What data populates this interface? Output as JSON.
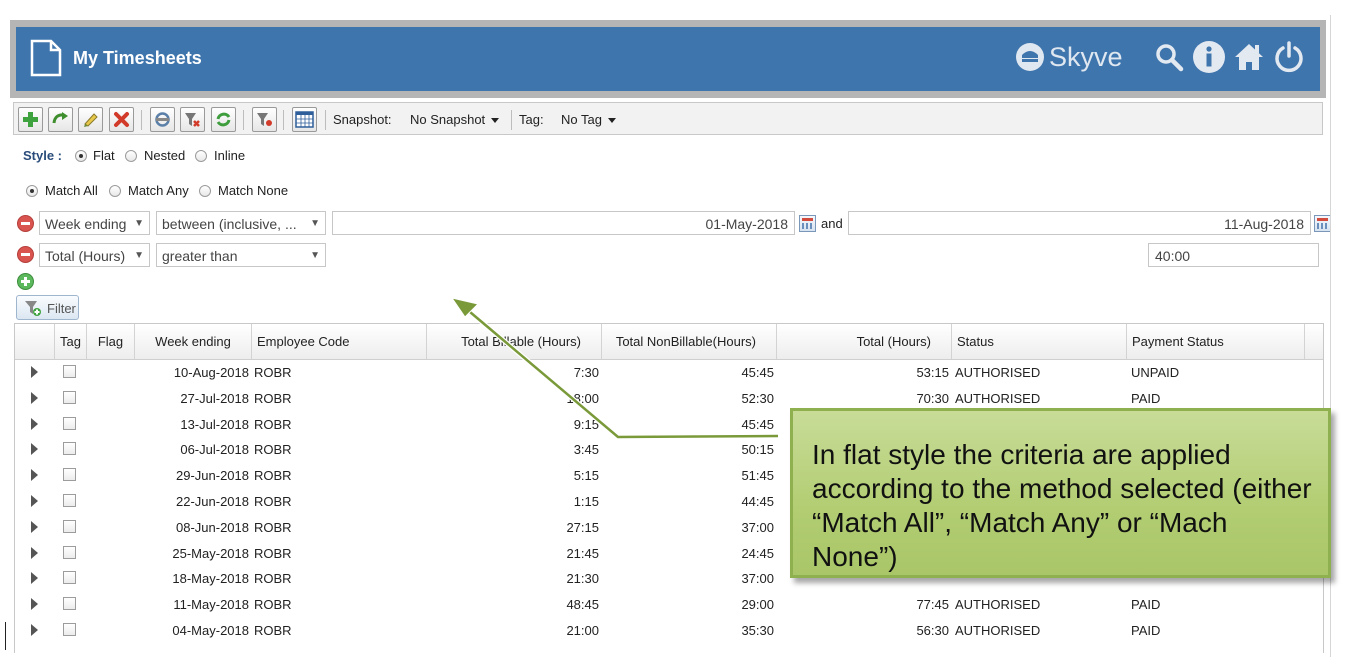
{
  "header": {
    "title": "My Timesheets",
    "brand": "Skyve",
    "icons": [
      "document-icon",
      "search-icon",
      "info-icon",
      "home-icon",
      "power-icon"
    ],
    "bg_color": "#3f75ad"
  },
  "toolbar": {
    "buttons": [
      "add-icon",
      "zoom-in-icon",
      "edit-icon",
      "delete-icon",
      "refresh-icon",
      "clear-filter-icon",
      "reload-icon",
      "summary-icon",
      "calendar-icon"
    ],
    "snapshot_label": "Snapshot:",
    "snapshot_value": "No Snapshot",
    "tag_label": "Tag:",
    "tag_value": "No Tag"
  },
  "style": {
    "label": "Style :",
    "options": [
      "Flat",
      "Nested",
      "Inline"
    ],
    "selected": "Flat"
  },
  "match": {
    "options": [
      "Match All",
      "Match Any",
      "Match None"
    ],
    "selected": "Match All"
  },
  "criteria": [
    {
      "field": "Week ending",
      "operator": "between (inclusive, ...",
      "value1": "01-May-2018",
      "conjunction": "and",
      "value2": "11-Aug-2018"
    },
    {
      "field": "Total (Hours)",
      "operator": "greater than",
      "value1": "40:00"
    }
  ],
  "filter_button": "Filter",
  "grid": {
    "columns": [
      "Tag",
      "Flag",
      "Week ending",
      "Employee Code",
      "Total Billable (Hours)",
      "Total NonBillable(Hours)",
      "Total (Hours)",
      "Status",
      "Payment Status"
    ],
    "rows": [
      {
        "week": "10-Aug-2018",
        "emp": "ROBR",
        "bill": "7:30",
        "nonbill": "45:45",
        "total": "53:15",
        "status": "AUTHORISED",
        "pay": "UNPAID"
      },
      {
        "week": "27-Jul-2018",
        "emp": "ROBR",
        "bill": "18:00",
        "nonbill": "52:30",
        "total": "70:30",
        "status": "AUTHORISED",
        "pay": "PAID"
      },
      {
        "week": "13-Jul-2018",
        "emp": "ROBR",
        "bill": "9:15",
        "nonbill": "45:45",
        "total": "",
        "status": "",
        "pay": ""
      },
      {
        "week": "06-Jul-2018",
        "emp": "ROBR",
        "bill": "3:45",
        "nonbill": "50:15",
        "total": "",
        "status": "",
        "pay": ""
      },
      {
        "week": "29-Jun-2018",
        "emp": "ROBR",
        "bill": "5:15",
        "nonbill": "51:45",
        "total": "",
        "status": "",
        "pay": ""
      },
      {
        "week": "22-Jun-2018",
        "emp": "ROBR",
        "bill": "1:15",
        "nonbill": "44:45",
        "total": "",
        "status": "",
        "pay": ""
      },
      {
        "week": "08-Jun-2018",
        "emp": "ROBR",
        "bill": "27:15",
        "nonbill": "37:00",
        "total": "",
        "status": "",
        "pay": ""
      },
      {
        "week": "25-May-2018",
        "emp": "ROBR",
        "bill": "21:45",
        "nonbill": "24:45",
        "total": "",
        "status": "",
        "pay": ""
      },
      {
        "week": "18-May-2018",
        "emp": "ROBR",
        "bill": "21:30",
        "nonbill": "37:00",
        "total": "",
        "status": "",
        "pay": ""
      },
      {
        "week": "11-May-2018",
        "emp": "ROBR",
        "bill": "48:45",
        "nonbill": "29:00",
        "total": "77:45",
        "status": "AUTHORISED",
        "pay": "PAID"
      },
      {
        "week": "04-May-2018",
        "emp": "ROBR",
        "bill": "21:00",
        "nonbill": "35:30",
        "total": "56:30",
        "status": "AUTHORISED",
        "pay": "PAID"
      }
    ]
  },
  "callout": {
    "text": "In flat style the criteria are applied according to the method selected (either “Match All”, “Match Any” or “Mach None”)",
    "color": "#b2cd72"
  }
}
